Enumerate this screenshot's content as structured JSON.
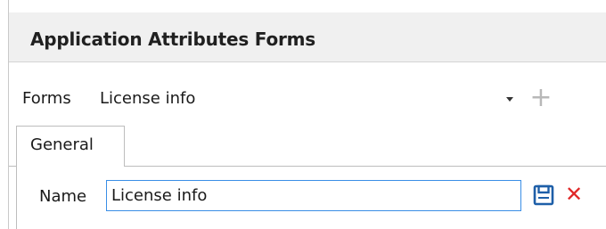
{
  "header": {
    "title": "Application Attributes Forms"
  },
  "forms": {
    "label": "Forms",
    "selected": "License info",
    "add_symbol": "+"
  },
  "tabs": [
    {
      "label": "General",
      "active": true
    }
  ],
  "general": {
    "name_label": "Name",
    "name_value": "License info",
    "close_symbol": "✕"
  },
  "colors": {
    "title_bar_bg": "#f0f0f0",
    "input_focus_border": "#3a8ee6",
    "save_icon": "#1e5fa8",
    "delete_icon": "#e02828",
    "add_icon_disabled": "#b8b8b8"
  }
}
